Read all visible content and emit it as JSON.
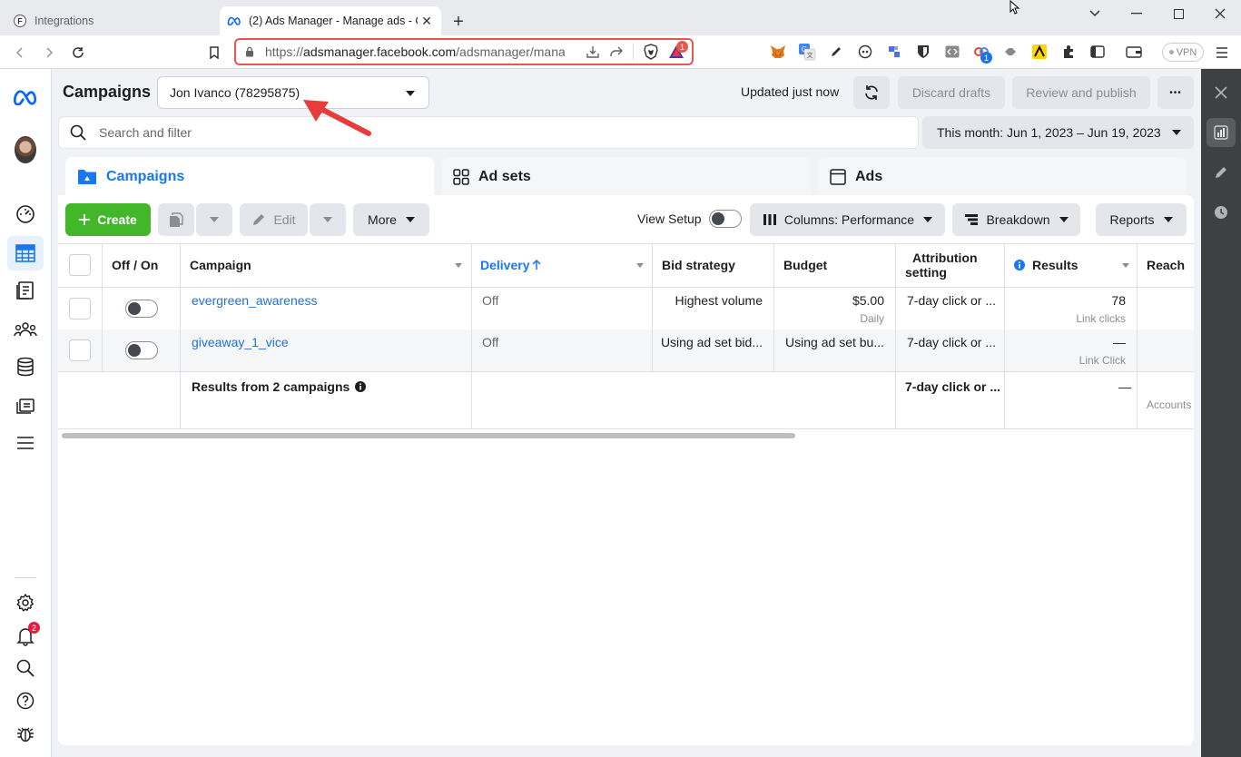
{
  "browser": {
    "tabs": [
      {
        "title": "Integrations",
        "active": false
      },
      {
        "title": "(2) Ads Manager - Manage ads - C",
        "active": true
      }
    ],
    "url": {
      "scheme": "https://",
      "host": "adsmanager.facebook.com",
      "path": "/adsmanager/mana"
    },
    "vpn_label": "VPN",
    "extension_badge": "1",
    "ext_badge_small": "1"
  },
  "rail": {
    "notifications_badge": "2"
  },
  "header": {
    "title": "Campaigns",
    "account": "Jon Ivanco (78295875)",
    "updated": "Updated just now",
    "discard_label": "Discard drafts",
    "review_label": "Review and publish",
    "more_label": "•••"
  },
  "search": {
    "placeholder": "Search and filter",
    "date_range": "This month: Jun 1, 2023 – Jun 19, 2023"
  },
  "level_tabs": [
    {
      "label": "Campaigns",
      "active": true
    },
    {
      "label": "Ad sets",
      "active": false
    },
    {
      "label": "Ads",
      "active": false
    }
  ],
  "toolbar": {
    "create_label": "Create",
    "edit_label": "Edit",
    "more_label": "More",
    "view_setup_label": "View Setup",
    "columns_label": "Columns: Performance",
    "breakdown_label": "Breakdown",
    "reports_label": "Reports"
  },
  "table": {
    "columns": {
      "off_on": "Off / On",
      "campaign": "Campaign",
      "delivery": "Delivery",
      "bid_strategy": "Bid strategy",
      "budget": "Budget",
      "attribution_line1": "Attribution",
      "attribution_line2": "setting",
      "results": "Results",
      "reach": "Reach"
    },
    "rows": [
      {
        "campaign": "evergreen_awareness",
        "delivery": "Off",
        "bid_strategy": "Highest volume",
        "budget": "$5.00",
        "budget_sub": "Daily",
        "attribution": "7-day click or ...",
        "results": "78",
        "results_sub": "Link clicks",
        "reach": ""
      },
      {
        "campaign": "giveaway_1_vice",
        "delivery": "Off",
        "bid_strategy": "Using ad set bid...",
        "budget": "Using ad set bu...",
        "budget_sub": "",
        "attribution": "7-day click or ...",
        "results": "—",
        "results_sub": "Link Click",
        "reach": ""
      }
    ],
    "summary": {
      "label": "Results from 2 campaigns",
      "attribution": "7-day click or ...",
      "results": "—",
      "reach_sub": "Accounts"
    }
  },
  "colors": {
    "accent": "#1877f2",
    "create": "#42b72a",
    "annotation_arrow": "#e83b3b",
    "link": "#216fdb"
  }
}
